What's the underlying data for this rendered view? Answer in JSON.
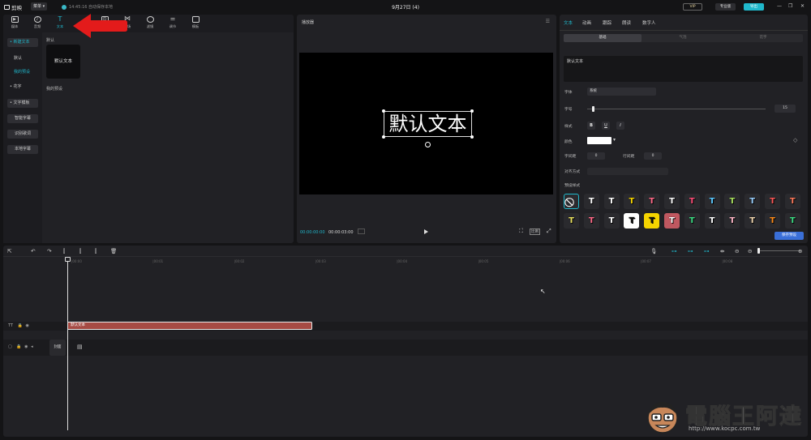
{
  "app": {
    "name": "剪映",
    "menu_label": "菜单",
    "save_status": "14:45:16 自动保存本地",
    "doc_title": "9月27日 (4)",
    "vip_label": "VIP",
    "pro_label": "专业版",
    "export_label": "导出"
  },
  "tools": [
    {
      "label": "媒体"
    },
    {
      "label": "音频"
    },
    {
      "label": "文本"
    },
    {
      "label": "贴纸"
    },
    {
      "label": "特效"
    },
    {
      "label": "转场"
    },
    {
      "label": "滤镜"
    },
    {
      "label": "调节"
    },
    {
      "label": "模板"
    }
  ],
  "side_nav": {
    "new_text": "• 新建文本",
    "default": "默认",
    "my_presets": "我的预设",
    "flower_text": "• 花字",
    "text_template": "• 文字模板",
    "smart_caption": "智能字幕",
    "recognize_lyrics": "识别歌词",
    "local_caption": "本地字幕"
  },
  "library": {
    "default_section": "默认",
    "default_tile": "默认文本",
    "my_presets_section": "我的预设"
  },
  "player": {
    "title": "播放器",
    "canvas_text": "默认文本",
    "time_current": "00:00:00:00",
    "time_total": "00:00:03:00",
    "ratio_label": "比例"
  },
  "inspector": {
    "tabs": [
      "文本",
      "动画",
      "跟踪",
      "朗读",
      "数字人"
    ],
    "subtabs": [
      "基础",
      "气泡",
      "花字"
    ],
    "text_value": "默认文本",
    "font_label": "字体",
    "font_value": "系统",
    "size_label": "字号",
    "size_value": "15",
    "style_label": "样式",
    "style_buttons": [
      "B",
      "U",
      "I"
    ],
    "color_label": "颜色",
    "char_spacing_label": "字间距",
    "char_spacing_value": "0",
    "line_spacing_label": "行间距",
    "line_spacing_value": "0",
    "align_label": "对齐方式",
    "presets_label": "预设样式",
    "save_preset": "保存预设",
    "preset_colors": [
      [
        "#ffffff",
        "#ffffff",
        "#f5d400",
        "#ff6b8a",
        "#ffffff",
        "#ff4f7a",
        "#5bc8ff",
        "#a8e05f",
        "#9ad0ff",
        "#ff5959",
        "#ff7a5c"
      ],
      [
        "#e8e060",
        "#ff6b8a",
        "#ffffff",
        "#ffffff",
        "#f5d400",
        "#e0707a",
        "#3ddc84",
        "#ffffff",
        "#ffb6c8",
        "#f2d7b0",
        "#ff8c1a",
        "#3ddc84"
      ]
    ]
  },
  "timeline": {
    "ruler": [
      "00:00",
      "00:01",
      "00:02",
      "00:03",
      "00:04",
      "00:05",
      "00:06",
      "00:07",
      "00:08"
    ],
    "text_clip_label": "默认文本",
    "cover_label": "封面",
    "track_text_icon": "TT",
    "track_video_icon": "▢"
  },
  "watermark": {
    "title": "電腦王阿達",
    "url": "http://www.kocpc.com.tw"
  }
}
